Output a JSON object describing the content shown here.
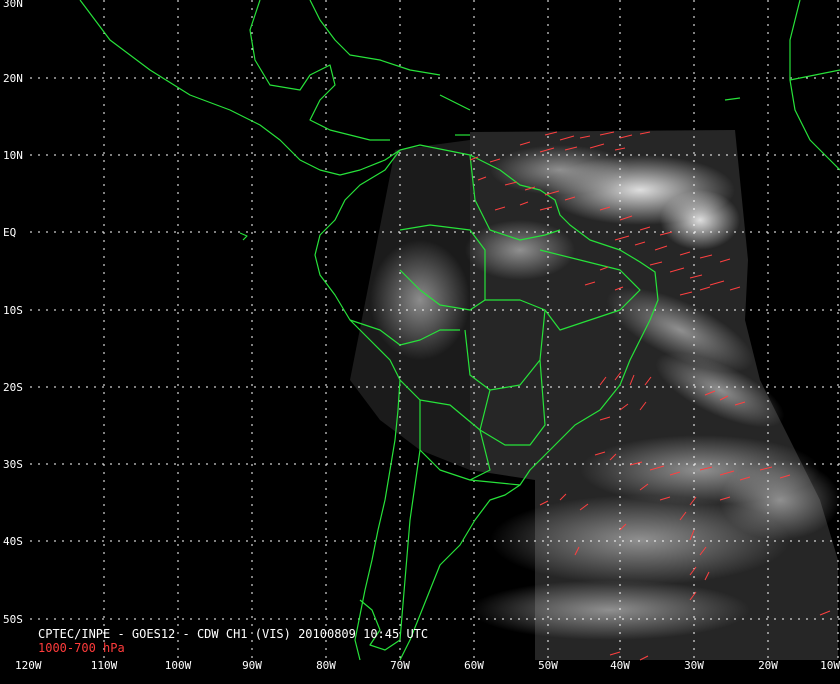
{
  "map": {
    "latitude_labels": [
      "30N",
      "20N",
      "10N",
      "EQ",
      "10S",
      "20S",
      "30S",
      "40S",
      "50S"
    ],
    "longitude_labels": [
      "120W",
      "110W",
      "100W",
      "90W",
      "80W",
      "70W",
      "60W",
      "50W",
      "40W",
      "30W",
      "20W",
      "10W"
    ],
    "caption": "CPTEC/INPE - GOES12 - CDW CH1 (VIS) 20100809 10:45 UTC",
    "subcaption": "1000-700 hPa",
    "colors": {
      "background": "#000000",
      "coastline": "#27e23a",
      "wind_vectors": "#ff4040",
      "grid": "#ffffff",
      "caption": "#ffffff",
      "subcaption": "#ff3b3b"
    },
    "gridlines": "dotted",
    "projection": "lat-lon"
  }
}
